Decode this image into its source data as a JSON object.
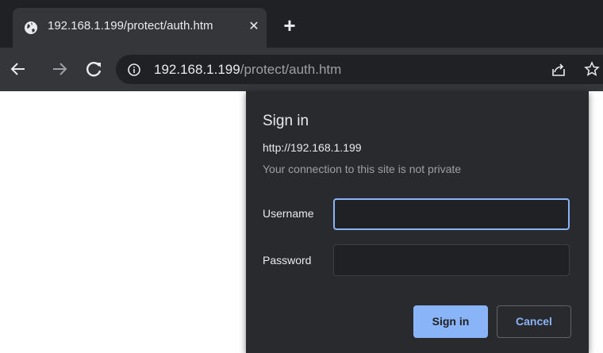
{
  "tab": {
    "title": "192.168.1.199/protect/auth.htm",
    "close_glyph": "✕",
    "new_tab_glyph": "+"
  },
  "toolbar": {
    "url_host": "192.168.1.199",
    "url_path": "/protect/auth.htm"
  },
  "dialog": {
    "title": "Sign in",
    "origin": "http://192.168.1.199",
    "warning": "Your connection to this site is not private",
    "username_label": "Username",
    "username_value": "",
    "password_label": "Password",
    "password_value": "",
    "sign_in_label": "Sign in",
    "cancel_label": "Cancel"
  },
  "colors": {
    "tabstrip": "#202124",
    "toolbar": "#35363a",
    "dialog": "#292a2d",
    "accent": "#8ab4f8"
  },
  "icons": [
    "globe-icon",
    "close-icon",
    "plus-icon",
    "back-arrow-icon",
    "forward-arrow-icon",
    "reload-icon",
    "info-icon",
    "share-icon",
    "star-icon"
  ]
}
